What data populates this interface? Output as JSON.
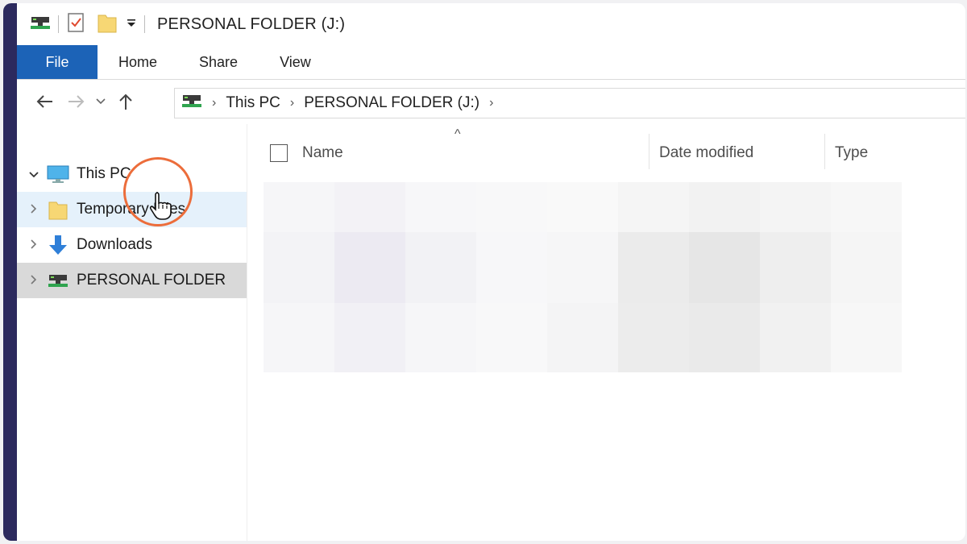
{
  "window": {
    "title": "PERSONAL FOLDER (J:)"
  },
  "ribbon": {
    "tabs": [
      "File",
      "Home",
      "Share",
      "View"
    ]
  },
  "address_bar": {
    "crumbs": [
      "This PC",
      "PERSONAL FOLDER (J:)"
    ]
  },
  "nav_pane": {
    "items": [
      {
        "label": "This PC",
        "icon": "monitor-icon",
        "expanded": true
      },
      {
        "label": "Temporary Files",
        "icon": "folder-icon",
        "expanded": false
      },
      {
        "label": "Downloads",
        "icon": "download-arrow-icon",
        "expanded": false
      },
      {
        "label": "PERSONAL FOLDER",
        "icon": "network-drive-icon",
        "expanded": false
      }
    ]
  },
  "file_list": {
    "columns": [
      "Name",
      "Date modified",
      "Type"
    ],
    "sort_indicator": "^"
  },
  "colors": {
    "file_tab": "#1c63b7",
    "left_bar": "#2c2a5e",
    "cursor_ring": "#ec6d3b",
    "hover_row": "#e5f1fb",
    "selected_row": "#d9d9d9"
  }
}
